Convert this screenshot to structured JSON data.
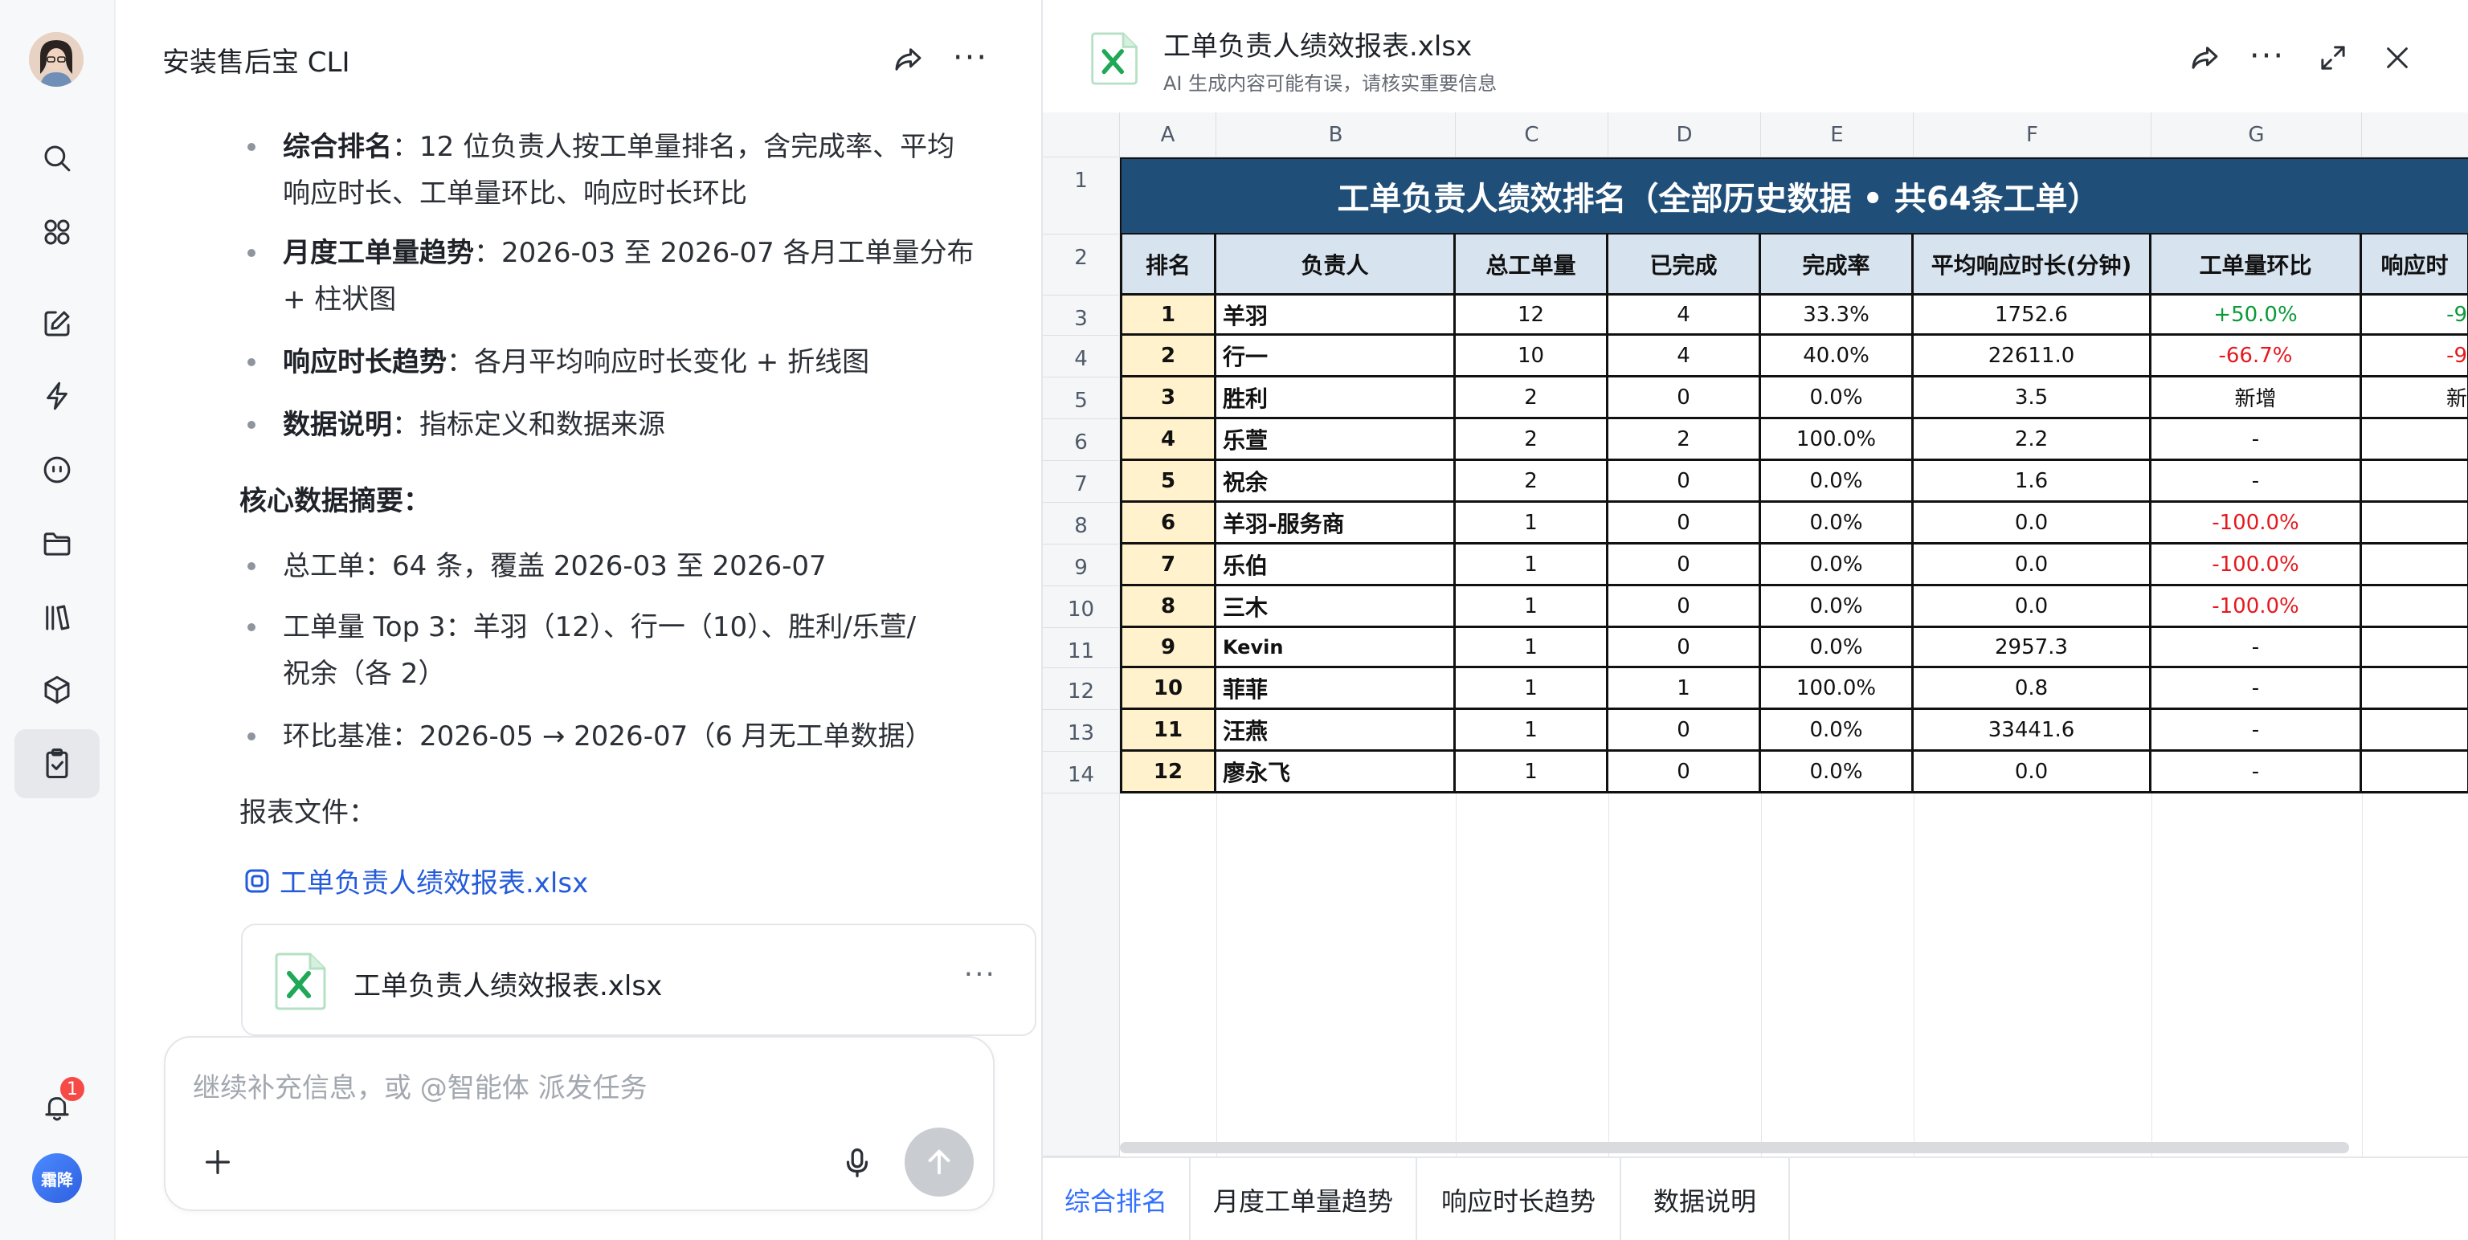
{
  "chat": {
    "title": "安装售后宝 CLI",
    "items": [
      {
        "bold": "综合排名",
        "text": "：12 位负责人按工单量排名，含完成率、平均",
        "text2": "响应时长、工单量环比、响应时长环比"
      },
      {
        "bold": "月度工单量趋势",
        "text": "：2026-03 至 2026-07 各月工单量分布",
        "text2": "+ 柱状图"
      },
      {
        "bold": "响应时长趋势",
        "text": "：各月平均响应时长变化 + 折线图"
      },
      {
        "bold": "数据说明",
        "text": "：指标定义和数据来源"
      }
    ],
    "summary_heading": "核心数据摘要：",
    "summary": [
      {
        "text": "总工单：64 条，覆盖 2026-03 至 2026-07"
      },
      {
        "text": "工单量 Top 3：羊羽（12）、行一（10）、胜利/乐萱/",
        "text2": "祝余（各 2）"
      },
      {
        "text": "环比基准：2026-05 → 2026-07（6 月无工单数据）"
      }
    ],
    "report_label": "报表文件：",
    "file_link": "工单负责人绩效报表.xlsx",
    "file_card_name": "工单负责人绩效报表.xlsx",
    "input_placeholder": "继续补充信息，或 @智能体 派发任务"
  },
  "rail": {
    "badge_count": "1",
    "user_initials": "霜降"
  },
  "preview": {
    "title": "工单负责人绩效报表.xlsx",
    "subtitle": "AI 生成内容可能有误，请核实重要信息",
    "columns": [
      "A",
      "B",
      "C",
      "D",
      "E",
      "F",
      "G"
    ],
    "row_numbers": [
      "1",
      "2",
      "3",
      "4",
      "5",
      "6",
      "7",
      "8",
      "9",
      "10",
      "11",
      "12",
      "13",
      "14"
    ],
    "banner": "工单负责人绩效排名（全部历史数据 • 共64条工单）",
    "headers": [
      "排名",
      "负责人",
      "总工单量",
      "已完成",
      "完成率",
      "平均响应时长(分钟)",
      "工单量环比",
      "响应时"
    ],
    "rows": [
      {
        "rank": "1",
        "name": "羊羽",
        "total": "12",
        "done": "4",
        "rate": "33.3%",
        "avg": "1752.6",
        "mom": "+50.0%",
        "mom_class": "pos",
        "rt": "-9"
      },
      {
        "rank": "2",
        "name": "行一",
        "total": "10",
        "done": "4",
        "rate": "40.0%",
        "avg": "22611.0",
        "mom": "-66.7%",
        "mom_class": "neg",
        "rt": "-9"
      },
      {
        "rank": "3",
        "name": "胜利",
        "total": "2",
        "done": "0",
        "rate": "0.0%",
        "avg": "3.5",
        "mom": "新增",
        "mom_class": "",
        "rt": "新"
      },
      {
        "rank": "4",
        "name": "乐萱",
        "total": "2",
        "done": "2",
        "rate": "100.0%",
        "avg": "2.2",
        "mom": "-",
        "mom_class": "",
        "rt": ""
      },
      {
        "rank": "5",
        "name": "祝余",
        "total": "2",
        "done": "0",
        "rate": "0.0%",
        "avg": "1.6",
        "mom": "-",
        "mom_class": "",
        "rt": ""
      },
      {
        "rank": "6",
        "name": "羊羽-服务商",
        "total": "1",
        "done": "0",
        "rate": "0.0%",
        "avg": "0.0",
        "mom": "-100.0%",
        "mom_class": "neg",
        "rt": ""
      },
      {
        "rank": "7",
        "name": "乐伯",
        "total": "1",
        "done": "0",
        "rate": "0.0%",
        "avg": "0.0",
        "mom": "-100.0%",
        "mom_class": "neg",
        "rt": ""
      },
      {
        "rank": "8",
        "name": "三木",
        "total": "1",
        "done": "0",
        "rate": "0.0%",
        "avg": "0.0",
        "mom": "-100.0%",
        "mom_class": "neg",
        "rt": ""
      },
      {
        "rank": "9",
        "name": "Kevin",
        "total": "1",
        "done": "0",
        "rate": "0.0%",
        "avg": "2957.3",
        "mom": "-",
        "mom_class": "",
        "rt": ""
      },
      {
        "rank": "10",
        "name": "菲菲",
        "total": "1",
        "done": "1",
        "rate": "100.0%",
        "avg": "0.8",
        "mom": "-",
        "mom_class": "",
        "rt": ""
      },
      {
        "rank": "11",
        "name": "汪燕",
        "total": "1",
        "done": "0",
        "rate": "0.0%",
        "avg": "33441.6",
        "mom": "-",
        "mom_class": "",
        "rt": ""
      },
      {
        "rank": "12",
        "name": "廖永飞",
        "total": "1",
        "done": "0",
        "rate": "0.0%",
        "avg": "0.0",
        "mom": "-",
        "mom_class": "",
        "rt": ""
      }
    ],
    "tabs": [
      "综合排名",
      "月度工单量趋势",
      "响应时长趋势",
      "数据说明"
    ],
    "active_tab": 0
  },
  "colors": {
    "banner": "#1f4e79",
    "header_fill": "#d7e3ef",
    "rank_fill": "#fff2cc",
    "positive": "#0b9a38",
    "negative": "#e5191e",
    "accent": "#3370ff",
    "link": "#245bdb"
  }
}
